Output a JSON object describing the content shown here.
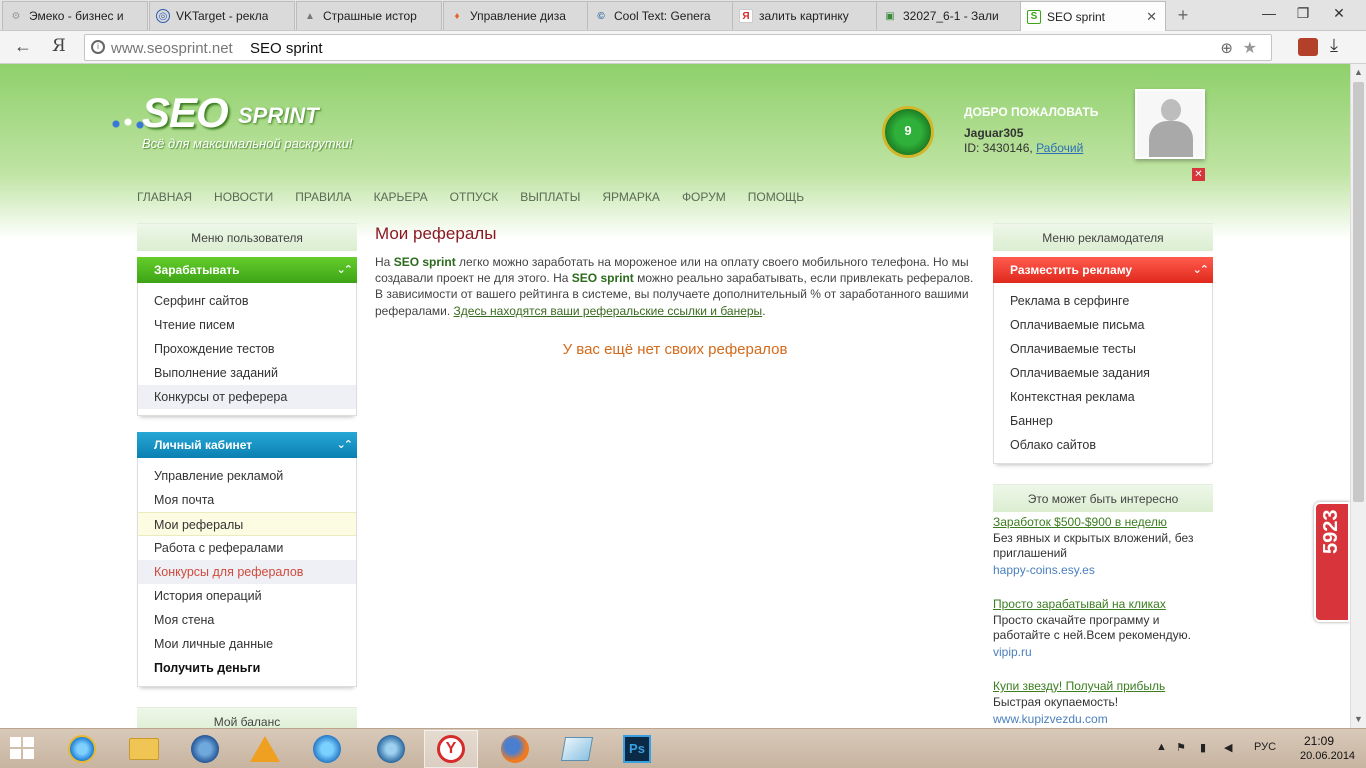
{
  "browser": {
    "tabs": [
      {
        "title": "Эмеко - бизнес и",
        "icon": "gear-icon",
        "color": "#999999"
      },
      {
        "title": "VKTarget - рекла",
        "icon": "vktarget-icon",
        "color": "#2a5db0"
      },
      {
        "title": "Страшные истор",
        "icon": "image-icon",
        "color": "#777777"
      },
      {
        "title": "Управление диза",
        "icon": "flame-icon",
        "color": "#e8632c"
      },
      {
        "title": "Cool Text: Genera",
        "icon": "cooltext-icon",
        "color": "#3a6ea5"
      },
      {
        "title": "залить картинку",
        "icon": "yandex-icon",
        "color": "#d62b2b"
      },
      {
        "title": "32027_6-1 - Зали",
        "icon": "image-icon",
        "color": "#3a8a3a"
      },
      {
        "title": "SEO sprint",
        "icon": "seosprint-icon",
        "color": "#3da416",
        "active": true
      }
    ],
    "new_tab": "+",
    "address": {
      "domain": "www.seosprint.net",
      "title": "SEO sprint"
    }
  },
  "header": {
    "logo_seo": "SEO",
    "logo_sprint": "SPRINT",
    "tagline": "Всё для максимальной раскрутки!",
    "level": "9",
    "welcome": "ДОБРО ПОЖАЛОВАТЬ",
    "username": "Jaguar305",
    "user_id_label": "ID: 3430146,",
    "user_status": "Рабочий",
    "close": "✕"
  },
  "nav": [
    "ГЛАВНАЯ",
    "НОВОСТИ",
    "ПРАВИЛА",
    "КАРЬЕРА",
    "ОТПУСК",
    "ВЫПЛАТЫ",
    "ЯРМАРКА",
    "ФОРУМ",
    "ПОМОЩЬ"
  ],
  "left": {
    "box_title": "Меню пользователя",
    "earn": {
      "title": "Зарабатывать",
      "items": [
        "Серфинг сайтов",
        "Чтение писем",
        "Прохождение тестов",
        "Выполнение заданий",
        "Конкурсы от реферера"
      ]
    },
    "cabinet": {
      "title": "Личный кабинет",
      "items": [
        "Управление рекламой",
        "Моя почта",
        "Мои рефералы",
        "Работа с рефералами",
        "Конкурсы для рефералов",
        "История операций",
        "Моя стена",
        "Мои личные данные",
        "Получить деньги"
      ]
    },
    "balance_title": "Мой баланс"
  },
  "content": {
    "title": "Мои рефералы",
    "p1": "На ",
    "brand": "SEO sprint",
    "p2": " легко можно заработать на мороженое или на оплату своего мобильного телефона. Но мы создавали проект не для этого. На ",
    "p3": " можно реально зарабатывать, если привлекать рефералов. В зависимости от вашего рейтинга в системе, вы получаете дополнительный % от заработанного вашими рефералами. ",
    "link": "Здесь находятся ваши реферальские ссылки и банеры",
    "p4": ".",
    "empty": "У вас ещё нет своих рефералов"
  },
  "right": {
    "box_title": "Меню рекламодателя",
    "ads_section": {
      "title": "Разместить рекламу",
      "items": [
        "Реклама в серфинге",
        "Оплачиваемые письма",
        "Оплачиваемые тесты",
        "Оплачиваемые задания",
        "Контекстная реклама",
        "Баннер",
        "Облако сайтов"
      ]
    },
    "interesting_title": "Это может быть интересно",
    "ads": [
      {
        "title": "Заработок $500-$900 в неделю",
        "desc": "Без явных и скрытых вложений, без приглашений",
        "url": "happy-coins.esy.es"
      },
      {
        "title": "Просто зарабатывай на кликах",
        "desc": "Просто скачайте программу и работайте с ней.Всем рекомендую.",
        "url": "vipip.ru"
      },
      {
        "title": "Купи звезду! Получай прибыль",
        "desc": "Быстрая окупаемость!",
        "url": "www.kupizvezdu.com"
      }
    ]
  },
  "widget": {
    "number": "5923"
  },
  "taskbar": {
    "lang": "РУС",
    "time": "21:09",
    "date": "20.06.2014"
  }
}
